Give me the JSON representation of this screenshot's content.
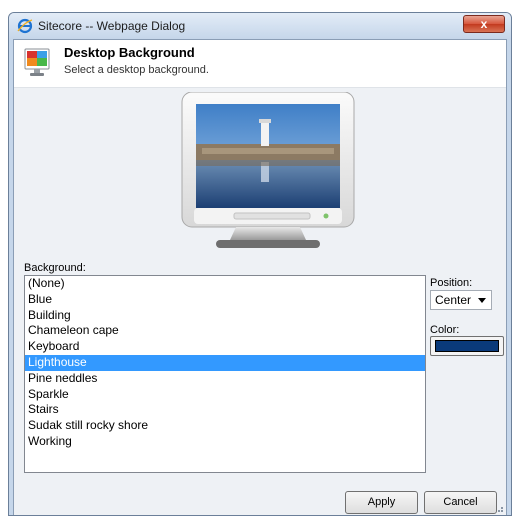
{
  "window": {
    "title": "Sitecore -- Webpage Dialog",
    "close_label": "x",
    "icon": "ie-icon"
  },
  "header": {
    "title": "Desktop Background",
    "subtitle": "Select a desktop background.",
    "icon": "desktop-background-icon"
  },
  "background": {
    "label": "Background:",
    "items": [
      {
        "label": "(None)"
      },
      {
        "label": "Blue"
      },
      {
        "label": "Building"
      },
      {
        "label": "Chameleon cape"
      },
      {
        "label": "Keyboard"
      },
      {
        "label": "Lighthouse",
        "selected": true
      },
      {
        "label": "Pine neddles"
      },
      {
        "label": "Sparkle"
      },
      {
        "label": "Stairs"
      },
      {
        "label": "Sudak still rocky shore"
      },
      {
        "label": "Working"
      }
    ]
  },
  "position": {
    "label": "Position:",
    "value": "Center"
  },
  "color": {
    "label": "Color:",
    "value": "#0a3a7a"
  },
  "buttons": {
    "apply": "Apply",
    "cancel": "Cancel"
  },
  "colors": {
    "selection": "#3399ff",
    "frame": "#c5d6ea",
    "close_button": "#c8442a"
  }
}
